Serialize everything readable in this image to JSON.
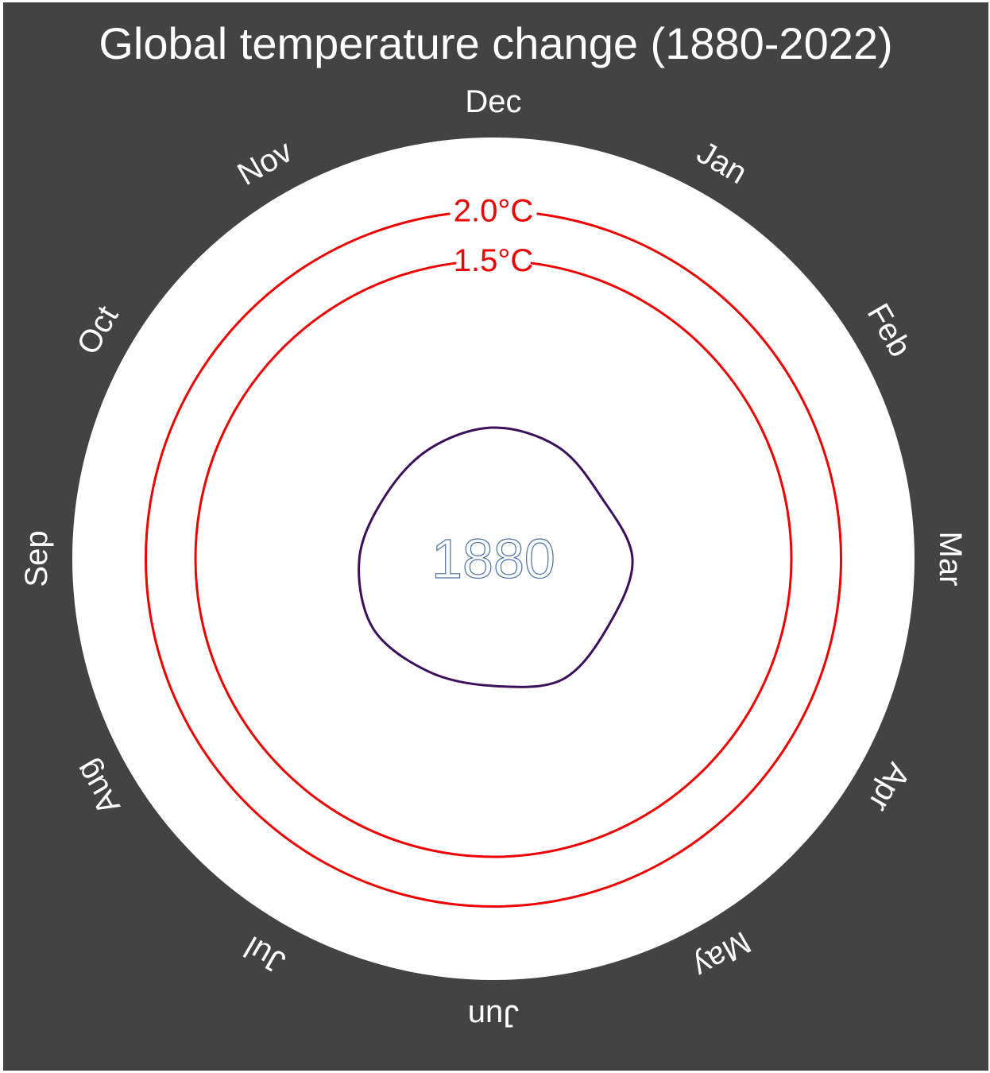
{
  "chart_data": {
    "type": "line",
    "coordinate_system": "polar",
    "title": "Global temperature change (1880-2022)",
    "months": [
      "Jan",
      "Feb",
      "Mar",
      "Apr",
      "May",
      "Jun",
      "Jul",
      "Aug",
      "Sep",
      "Oct",
      "Nov",
      "Dec"
    ],
    "thresholds": [
      {
        "label": "1.5°C",
        "value": 1.5,
        "color": "#ee0000"
      },
      {
        "label": "2.0°C",
        "value": 2.0,
        "color": "#ee0000"
      }
    ],
    "series": [
      {
        "year_label": "1880",
        "color": "#3b0f5a",
        "values": [
          -0.2,
          -0.25,
          -0.1,
          -0.16,
          -0.1,
          -0.22,
          -0.19,
          -0.1,
          -0.15,
          -0.24,
          -0.22,
          -0.18
        ]
      }
    ],
    "rlim": [
      -1.5,
      2.3
    ],
    "background_panel": "#ffffff",
    "background_outer": "#434343",
    "grid": false,
    "legend": "none"
  }
}
